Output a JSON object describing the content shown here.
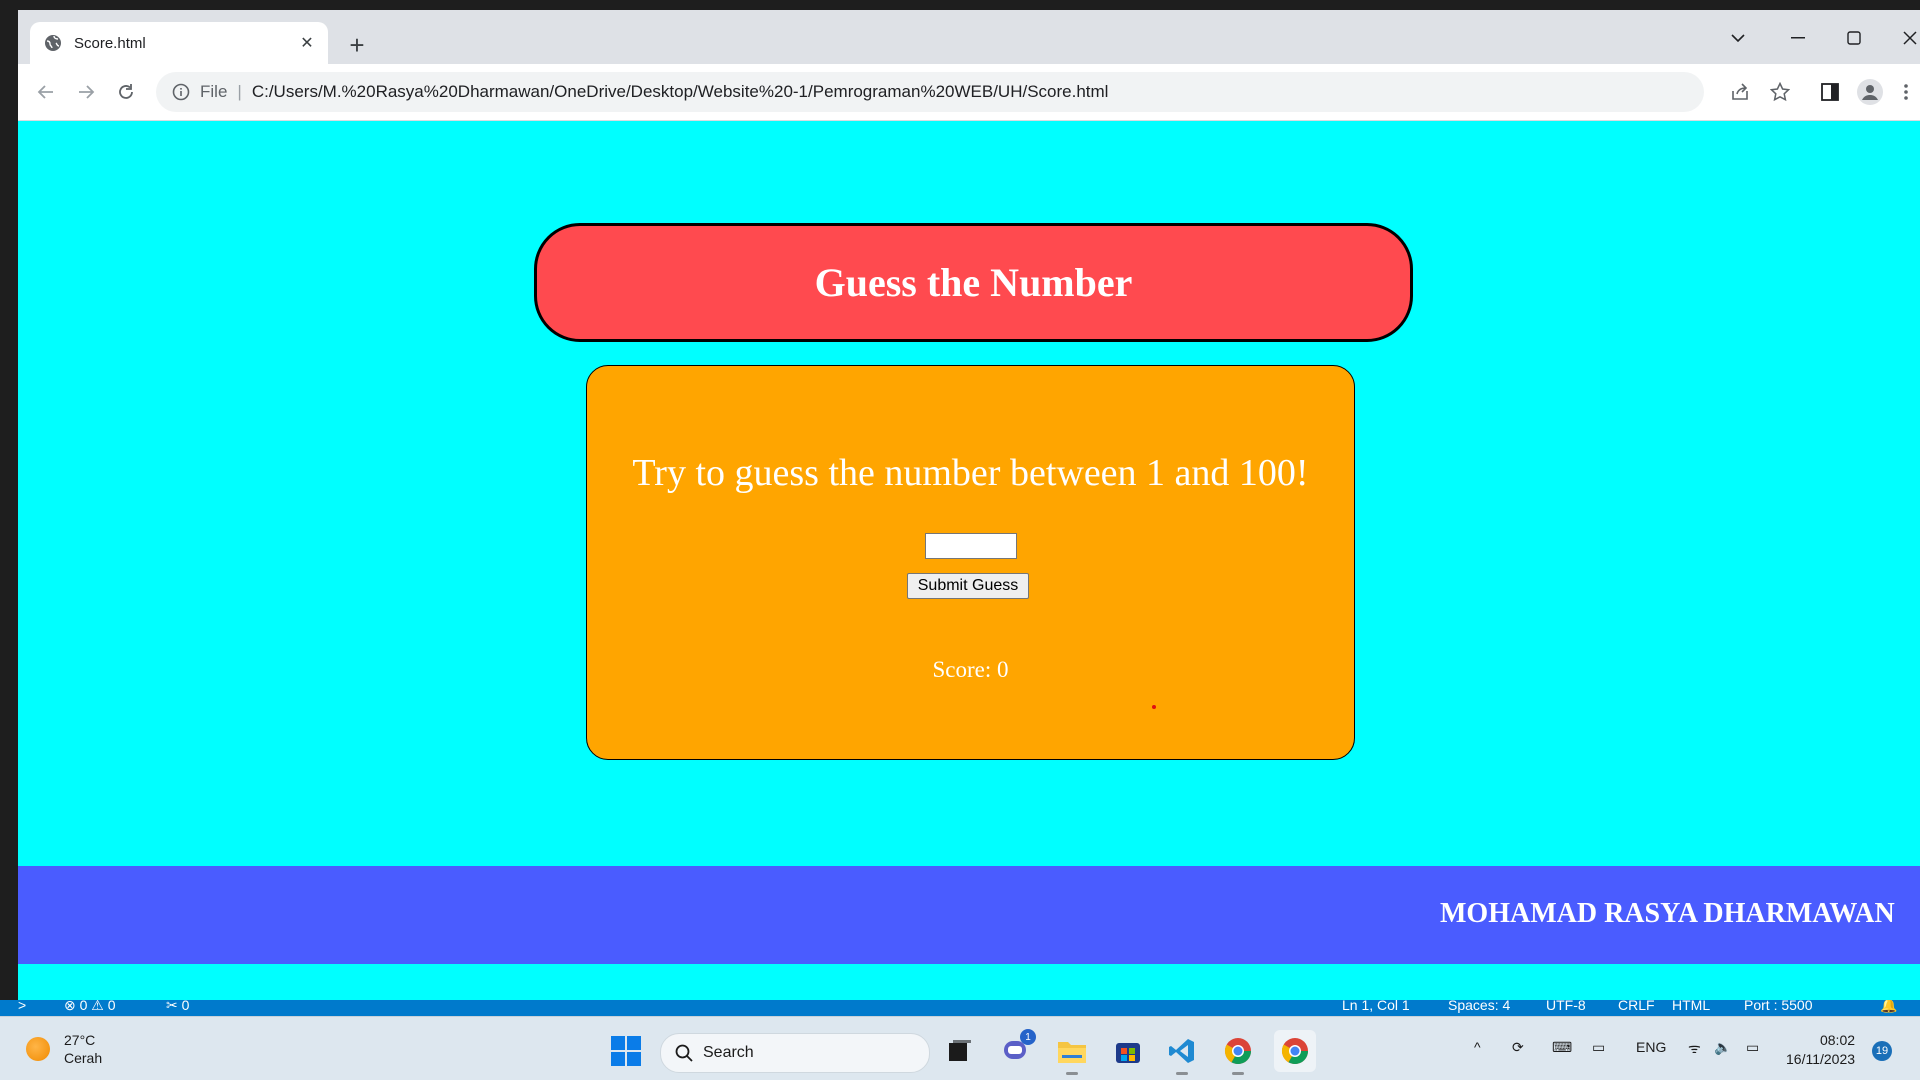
{
  "browser": {
    "tab_title": "Score.html",
    "new_tab_symbol": "+",
    "scheme_label": "File",
    "url": "C:/Users/M.%20Rasya%20Dharmawan/OneDrive/Desktop/Website%20-1/Pemrograman%20WEB/UH/Score.html"
  },
  "page": {
    "title": "Guess the Number",
    "prompt": "Try to guess the number between 1 and 100!",
    "guess_value": "",
    "submit_label": "Submit Guess",
    "score_text": "Score: 0",
    "footer_name": "MOHAMAD RASYA DHARMAWAN"
  },
  "statusbar": {
    "problems": "⊗ 0 ⚠ 0",
    "ports": "✂ 0",
    "position": "Ln 1, Col 1",
    "spaces": "Spaces: 4",
    "encoding": "UTF-8",
    "eol": "CRLF",
    "language": "HTML",
    "port": "Port : 5500"
  },
  "taskbar": {
    "weather_temp": "27°C",
    "weather_desc": "Cerah",
    "search_label": "Search",
    "chat_badge": "1",
    "language": "ENG",
    "time": "08:02",
    "date": "16/11/2023",
    "notification_count": "19"
  },
  "colors": {
    "page_background": "#00ffff",
    "header_box": "#ff4a4f",
    "game_box": "#ffa500",
    "footer_band": "#4a5cff"
  }
}
